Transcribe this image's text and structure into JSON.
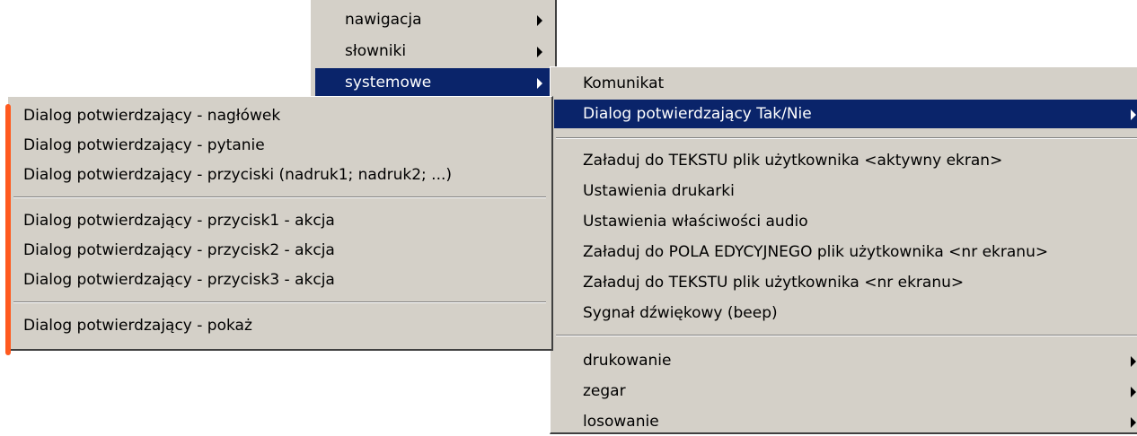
{
  "top_menu": {
    "items": [
      {
        "label": "nawigacja"
      },
      {
        "label": "słowniki"
      },
      {
        "label": "systemowe"
      }
    ]
  },
  "system_menu": {
    "group1": [
      {
        "label": "Komunikat"
      },
      {
        "label": "Dialog potwierdzający Tak/Nie"
      }
    ],
    "group2": [
      {
        "label": "Załaduj do TEKSTU plik użytkownika <aktywny ekran>"
      },
      {
        "label": "Ustawienia drukarki"
      },
      {
        "label": "Ustawienia właściwości audio"
      },
      {
        "label": "Załaduj do POLA EDYCYJNEGO plik użytkownika <nr ekranu>"
      },
      {
        "label": "Załaduj do TEKSTU plik użytkownika <nr ekranu>"
      },
      {
        "label": "Sygnał dźwiękowy (beep)"
      }
    ],
    "group3": [
      {
        "label": "drukowanie"
      },
      {
        "label": "zegar"
      },
      {
        "label": "losowanie"
      }
    ]
  },
  "dialog_menu": {
    "group1": [
      {
        "label": "Dialog potwierdzający - nagłówek"
      },
      {
        "label": "Dialog potwierdzający - pytanie"
      },
      {
        "label": "Dialog potwierdzający - przyciski (nadruk1; nadruk2; ...)"
      }
    ],
    "group2": [
      {
        "label": "Dialog potwierdzający - przycisk1 - akcja"
      },
      {
        "label": "Dialog potwierdzający - przycisk2 - akcja"
      },
      {
        "label": "Dialog potwierdzający - przycisk3 - akcja"
      }
    ],
    "group3": [
      {
        "label": "Dialog potwierdzający - pokaż"
      }
    ]
  },
  "colors": {
    "menu_bg": "#d4d0c8",
    "highlight": "#0a246a",
    "annotation_marker": "#ff5a1f"
  }
}
